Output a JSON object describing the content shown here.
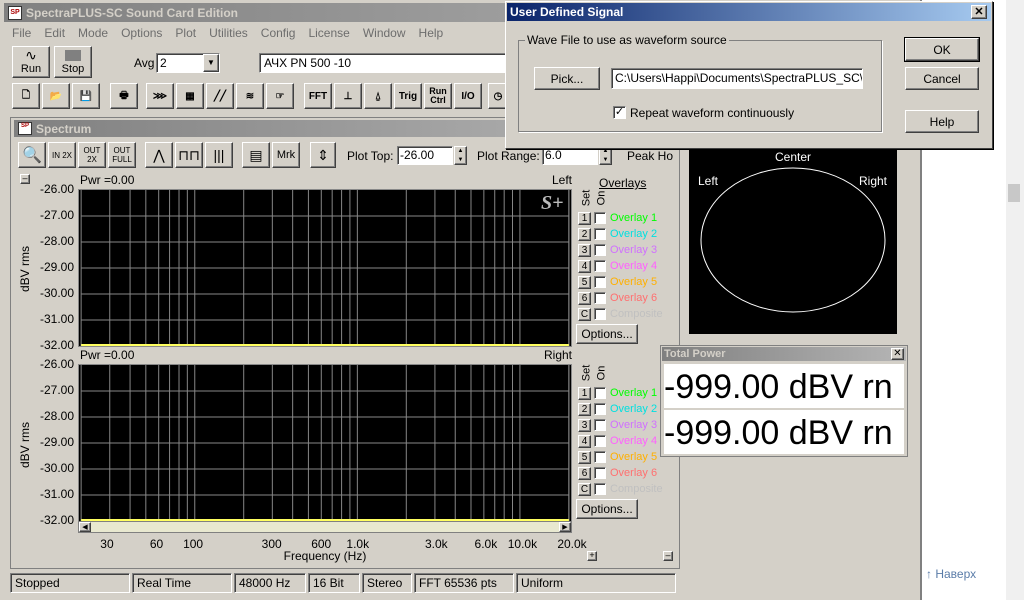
{
  "app": {
    "title": "SpectraPLUS-SC Sound Card Edition",
    "menu": [
      "File",
      "Edit",
      "Mode",
      "Options",
      "Plot",
      "Utilities",
      "Config",
      "License",
      "Window",
      "Help"
    ]
  },
  "toolbar": {
    "run": "Run",
    "stop": "Stop",
    "avg_label": "Avg",
    "avg_value": "2",
    "preset": "АЧХ PN 500 -10",
    "icons": [
      "new-icon",
      "open-icon",
      "save-icon",
      "print-icon",
      "filter-icon",
      "display-icon",
      "ramp-icon",
      "waterfall-icon",
      "hand-icon"
    ],
    "fft": "FFT",
    "trig": "Trig",
    "run_ctrl": "Run Ctrl",
    "io": "I/O"
  },
  "spectrum": {
    "title": "Spectrum",
    "zoom_labels": [
      "IN 2X",
      "OUT 2X",
      "OUT FULL"
    ],
    "mrk": "Mrk",
    "plot_top_label": "Plot Top:",
    "plot_top_value": "-26.00",
    "plot_range_label": "Plot Range:",
    "plot_range_value": "6.0",
    "peak_hold": "Peak Ho",
    "yticks": [
      "-26.00",
      "-27.00",
      "-28.00",
      "-29.00",
      "-30.00",
      "-31.00",
      "-32.00"
    ],
    "ylabel": "dBV rms",
    "xlabel": "Frequency (Hz)",
    "xticks": [
      "30",
      "60",
      "100",
      "300",
      "600",
      "1.0k",
      "3.0k",
      "6.0k",
      "10.0k",
      "20.0k"
    ],
    "top": {
      "pwr": "Pwr =0.00",
      "channel": "Left"
    },
    "bottom": {
      "pwr": "Pwr =0.00",
      "channel": "Right"
    },
    "logo": "S+",
    "overlays": {
      "title": "Overlays",
      "set": "Set",
      "on": "On",
      "options": "Options...",
      "items": [
        {
          "n": "1",
          "label": "Overlay 1",
          "color": "#00ff00"
        },
        {
          "n": "2",
          "label": "Overlay 2",
          "color": "#00e0e0"
        },
        {
          "n": "3",
          "label": "Overlay 3",
          "color": "#d070ff"
        },
        {
          "n": "4",
          "label": "Overlay 4",
          "color": "#ff60ff"
        },
        {
          "n": "5",
          "label": "Overlay 5",
          "color": "#ffb000"
        },
        {
          "n": "6",
          "label": "Overlay 6",
          "color": "#ff7070"
        },
        {
          "n": "C",
          "label": "Composite",
          "color": "#c0c0c0"
        }
      ]
    }
  },
  "phase": {
    "center": "Center",
    "left": "Left",
    "right": "Right"
  },
  "total_power": {
    "title": "Total Power",
    "left": "-999.00 dBV rn",
    "right": "-999.00 dBV rn"
  },
  "dialog": {
    "title": "User Defined Signal",
    "group": "Wave File to use as waveform source",
    "pick": "Pick...",
    "path": "C:\\Users\\Happi\\Documents\\SpectraPLUS_SC\\Wa",
    "repeat": "Repeat waveform continuously",
    "ok": "OK",
    "cancel": "Cancel",
    "help": "Help"
  },
  "status": [
    "Stopped",
    "Real Time",
    "48000 Hz",
    "16 Bit",
    "Stereo",
    "FFT 65536 pts",
    "Uniform"
  ],
  "browser": {
    "back_to_top": "Наверх"
  }
}
